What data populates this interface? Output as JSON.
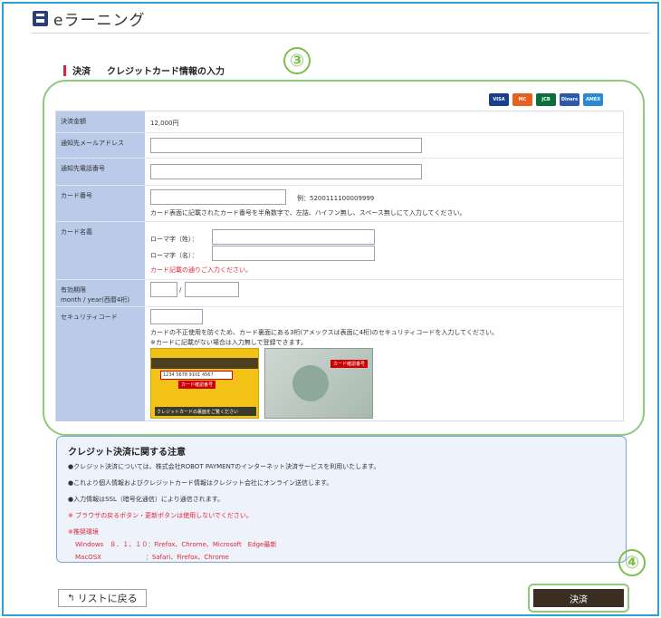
{
  "header": {
    "app_title": "eラーニング"
  },
  "section": {
    "label": "決済",
    "title": "クレジットカード情報の入力"
  },
  "steps": {
    "step3": "③",
    "step4": "④"
  },
  "card_brands": [
    {
      "name": "VISA",
      "color": "#1a3e8f"
    },
    {
      "name": "MC",
      "color": "#e8601e"
    },
    {
      "name": "JCB",
      "color": "#0a6f3a"
    },
    {
      "name": "Diners",
      "color": "#2c5aa8"
    },
    {
      "name": "AMEX",
      "color": "#2a8ad6"
    }
  ],
  "form": {
    "amount": {
      "label": "決済金額",
      "value": "12,000円"
    },
    "email": {
      "label": "通知先メールアドレス",
      "value": ""
    },
    "phone": {
      "label": "通知先電話番号",
      "value": ""
    },
    "card_number": {
      "label": "カード番号",
      "example": "例：5200111100009999",
      "hint": "カード表面に記載されたカード番号を半角数字で、左詰、ハイフン無し、スペース無しにて入力してください。"
    },
    "card_name": {
      "label": "カード名義",
      "last_label": "ローマ字（姓）：",
      "first_label": "ローマ字（名）：",
      "note": "カード記載の通りご入力ください。"
    },
    "expiry": {
      "label_line1": "有効期限",
      "label_line2": "month / year(西暦4桁)",
      "separator": "/"
    },
    "security": {
      "label": "セキュリティコード",
      "hint1": "カードの不正使用を防ぐため、カード裏面にある3桁(アメックスは表面に4桁)のセキュリティコードを入力してください。",
      "hint2": "※カードに記載がない場合は入力無しで登録できます。",
      "image1_caption": "クレジットカードの裏面をご覧ください",
      "image1_number": "1234 5678 9101 4567",
      "image1_code": "カード確認番号",
      "image2_code": "カード確認番号"
    }
  },
  "notice": {
    "title": "クレジット決済に関する注意",
    "lines": [
      "●クレジット決済については、株式会社ROBOT PAYMENTのインターネット決済サービスを利用いたします。",
      "●これより個人情報およびクレジットカード情報はクレジット会社にオンライン送信します。",
      "●入力情報はSSL（暗号化通信）により通信されます。",
      "※ ブラウザの戻るボタン・更新ボタンは使用しないでください。",
      "※推奨環境",
      "Windows　８．１、１０：Firefox、Chrome、Microsoft　Edge最新",
      "MacOSX　　　　　　　：Safari、Firefox、Chrome"
    ]
  },
  "buttons": {
    "back": "リストに戻る",
    "pay": "決済"
  }
}
